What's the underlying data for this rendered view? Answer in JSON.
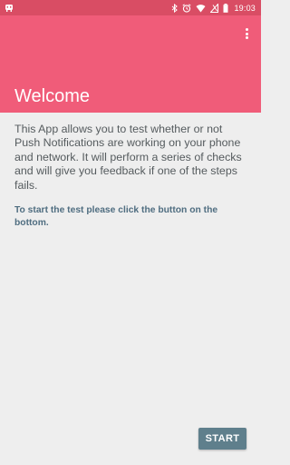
{
  "status_bar": {
    "time": "19:03",
    "icons": [
      "notification-app-icon",
      "bluetooth-icon",
      "alarm-icon",
      "wifi-icon",
      "no-sim-icon",
      "battery-icon"
    ]
  },
  "app_bar": {
    "title": "Welcome",
    "overflow_icon": "more-vert-icon",
    "color": "#f05c79"
  },
  "content": {
    "description": "This App allows you to test whether or not Push Notifications are working on your phone and network. It will perform a series of checks and will give you feedback if one of the steps fails.",
    "hint": "To start the test please click the button on the bottom."
  },
  "actions": {
    "start_label": "START",
    "button_color": "#5f7f8c"
  }
}
